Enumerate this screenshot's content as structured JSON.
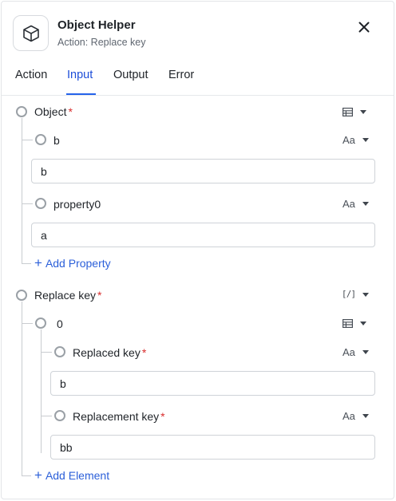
{
  "header": {
    "title": "Object Helper",
    "subtitle": "Action: Replace key"
  },
  "tabs": [
    {
      "label": "Action"
    },
    {
      "label": "Input"
    },
    {
      "label": "Output"
    },
    {
      "label": "Error"
    }
  ],
  "active_tab": "Input",
  "form": {
    "object": {
      "label": "Object",
      "required_mark": "*",
      "type_icon": "table-icon",
      "properties": [
        {
          "label": "b",
          "type_icon": "text-type-icon",
          "type_text": "Aa",
          "value": "b"
        },
        {
          "label": "property0",
          "type_icon": "text-type-icon",
          "type_text": "Aa",
          "value": "a"
        }
      ],
      "add_label": "Add Property"
    },
    "replace_key": {
      "label": "Replace key",
      "required_mark": "*",
      "type_text": "[/]",
      "element": {
        "label": "0",
        "type_icon": "table-icon",
        "replaced_key": {
          "label": "Replaced key",
          "required_mark": "*",
          "type_text": "Aa",
          "value": "b"
        },
        "replacement_key": {
          "label": "Replacement key",
          "required_mark": "*",
          "type_text": "Aa",
          "value": "bb"
        }
      },
      "add_label": "Add Element"
    }
  },
  "colors": {
    "accent": "#2563eb",
    "link": "#2b5fd9",
    "required": "#d92d2d",
    "border": "#cfd3d8"
  }
}
